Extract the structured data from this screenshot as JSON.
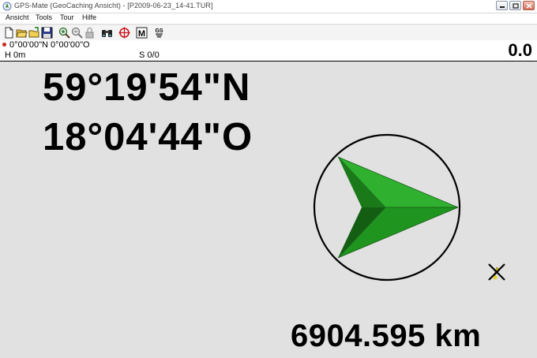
{
  "window": {
    "title": "GPS-Mate (GeoCaching Ansicht) - [P2009-06-23_14-41.TUR]",
    "icon": "app-icon"
  },
  "menu": {
    "items": [
      {
        "label": "Ansicht"
      },
      {
        "label": "Tools"
      },
      {
        "label": "Tour"
      },
      {
        "label": "Hilfe"
      }
    ]
  },
  "toolbar": {
    "buttons": [
      "new-file-icon",
      "open-folder-icon",
      "open-icon",
      "save-icon",
      "zoom-in-icon",
      "zoom-out-icon",
      "lock-icon",
      "binoculars-icon",
      "crosshair-icon",
      "map-icon",
      "gs-icon"
    ]
  },
  "status": {
    "position": "0°00'00\"N 0°00'00\"O",
    "height": "H 0m",
    "satellites": "S 0/0",
    "speed": "0.0"
  },
  "navigation": {
    "latitude": "59°19'54\"N",
    "longitude": "18°04'44\"O",
    "distance": "6904.595 km",
    "bearing_deg": 90,
    "arrow_color": "#1f9a1f"
  }
}
